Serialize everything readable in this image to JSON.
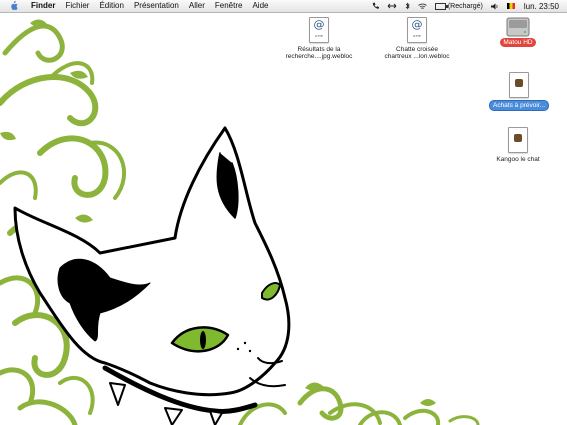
{
  "menubar": {
    "app": "Finder",
    "items": [
      "Fichier",
      "Édition",
      "Présentation",
      "Aller",
      "Fenêtre",
      "Aide"
    ],
    "battery_status": "(Rechargé)",
    "clock": "lun. 23:50"
  },
  "desktop": {
    "icons": [
      {
        "line1": "Résultats de la",
        "line2": "recherche....jpg.webloc"
      },
      {
        "line1": "Chatte croisée",
        "line2": "chartreux ...lon.webloc"
      },
      {
        "label": "Matou HD"
      },
      {
        "label": "Achats à prévoir..."
      },
      {
        "label": "Kangoo le chat"
      }
    ]
  },
  "colors": {
    "flourish": "#8cb43c",
    "eye": "#7fb92e",
    "label_red": "#e0463e",
    "label_blue": "#4a8cdc"
  }
}
